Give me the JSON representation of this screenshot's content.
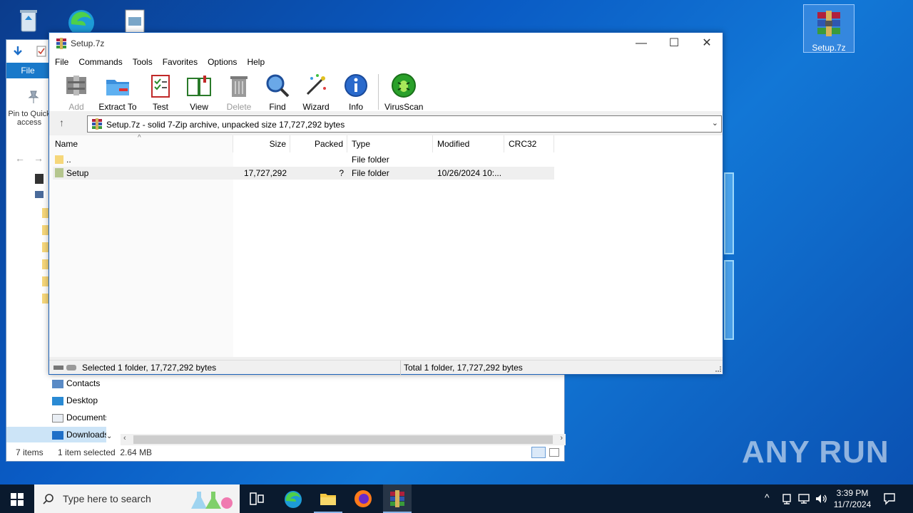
{
  "desktop": {
    "setup_icon_label": "Setup.7z"
  },
  "explorer": {
    "file_tab": "File",
    "pin_label": "Pin to Quick access",
    "nav_items": [
      "Contacts",
      "Desktop",
      "Documents",
      "Downloads"
    ],
    "status_items": "7 items",
    "status_selected": "1 item selected  2.64 MB"
  },
  "window": {
    "title": "Setup.7z",
    "menu": [
      "File",
      "Commands",
      "Tools",
      "Favorites",
      "Options",
      "Help"
    ],
    "toolbar": [
      {
        "label": "Add",
        "icon": "add-icon",
        "disabled": true
      },
      {
        "label": "Extract To",
        "icon": "extract-icon",
        "disabled": false
      },
      {
        "label": "Test",
        "icon": "test-icon",
        "disabled": false
      },
      {
        "label": "View",
        "icon": "view-icon",
        "disabled": false
      },
      {
        "label": "Delete",
        "icon": "delete-icon",
        "disabled": true
      },
      {
        "label": "Find",
        "icon": "find-icon",
        "disabled": false
      },
      {
        "label": "Wizard",
        "icon": "wizard-icon",
        "disabled": false
      },
      {
        "label": "Info",
        "icon": "info-icon",
        "disabled": false
      },
      {
        "label": "VirusScan",
        "icon": "virusscan-icon",
        "disabled": false
      }
    ],
    "address": "Setup.7z - solid 7-Zip archive, unpacked size 17,727,292 bytes",
    "columns": [
      "Name",
      "Size",
      "Packed",
      "Type",
      "Modified",
      "CRC32"
    ],
    "rows": [
      {
        "name": "..",
        "size": "",
        "packed": "",
        "type": "File folder",
        "modified": "",
        "crc": ""
      },
      {
        "name": "Setup",
        "size": "17,727,292",
        "packed": "?",
        "type": "File folder",
        "modified": "10/26/2024 10:...",
        "crc": ""
      }
    ],
    "status_left": "Selected 1 folder, 17,727,292 bytes",
    "status_right": "Total 1 folder, 17,727,292 bytes"
  },
  "taskbar": {
    "search_placeholder": "Type here to search",
    "time": "3:39 PM",
    "date": "11/7/2024"
  },
  "watermark": "ANY RUN"
}
